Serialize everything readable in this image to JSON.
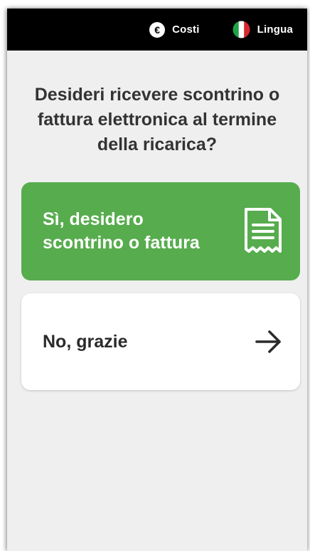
{
  "topbar": {
    "costs_icon": "euro-icon",
    "costs_label": "Costi",
    "language_icon": "italian-flag-icon",
    "language_label": "Lingua"
  },
  "question": "Desideri ricevere scontrino o fattura elettronica al termine della ricarica?",
  "options": {
    "yes": {
      "label": "Sì, desidero\nscontrino o fattura",
      "icon": "receipt-icon",
      "background": "#57ac4e"
    },
    "no": {
      "label": "No, grazie",
      "icon": "arrow-right-icon",
      "background": "#ffffff"
    }
  }
}
